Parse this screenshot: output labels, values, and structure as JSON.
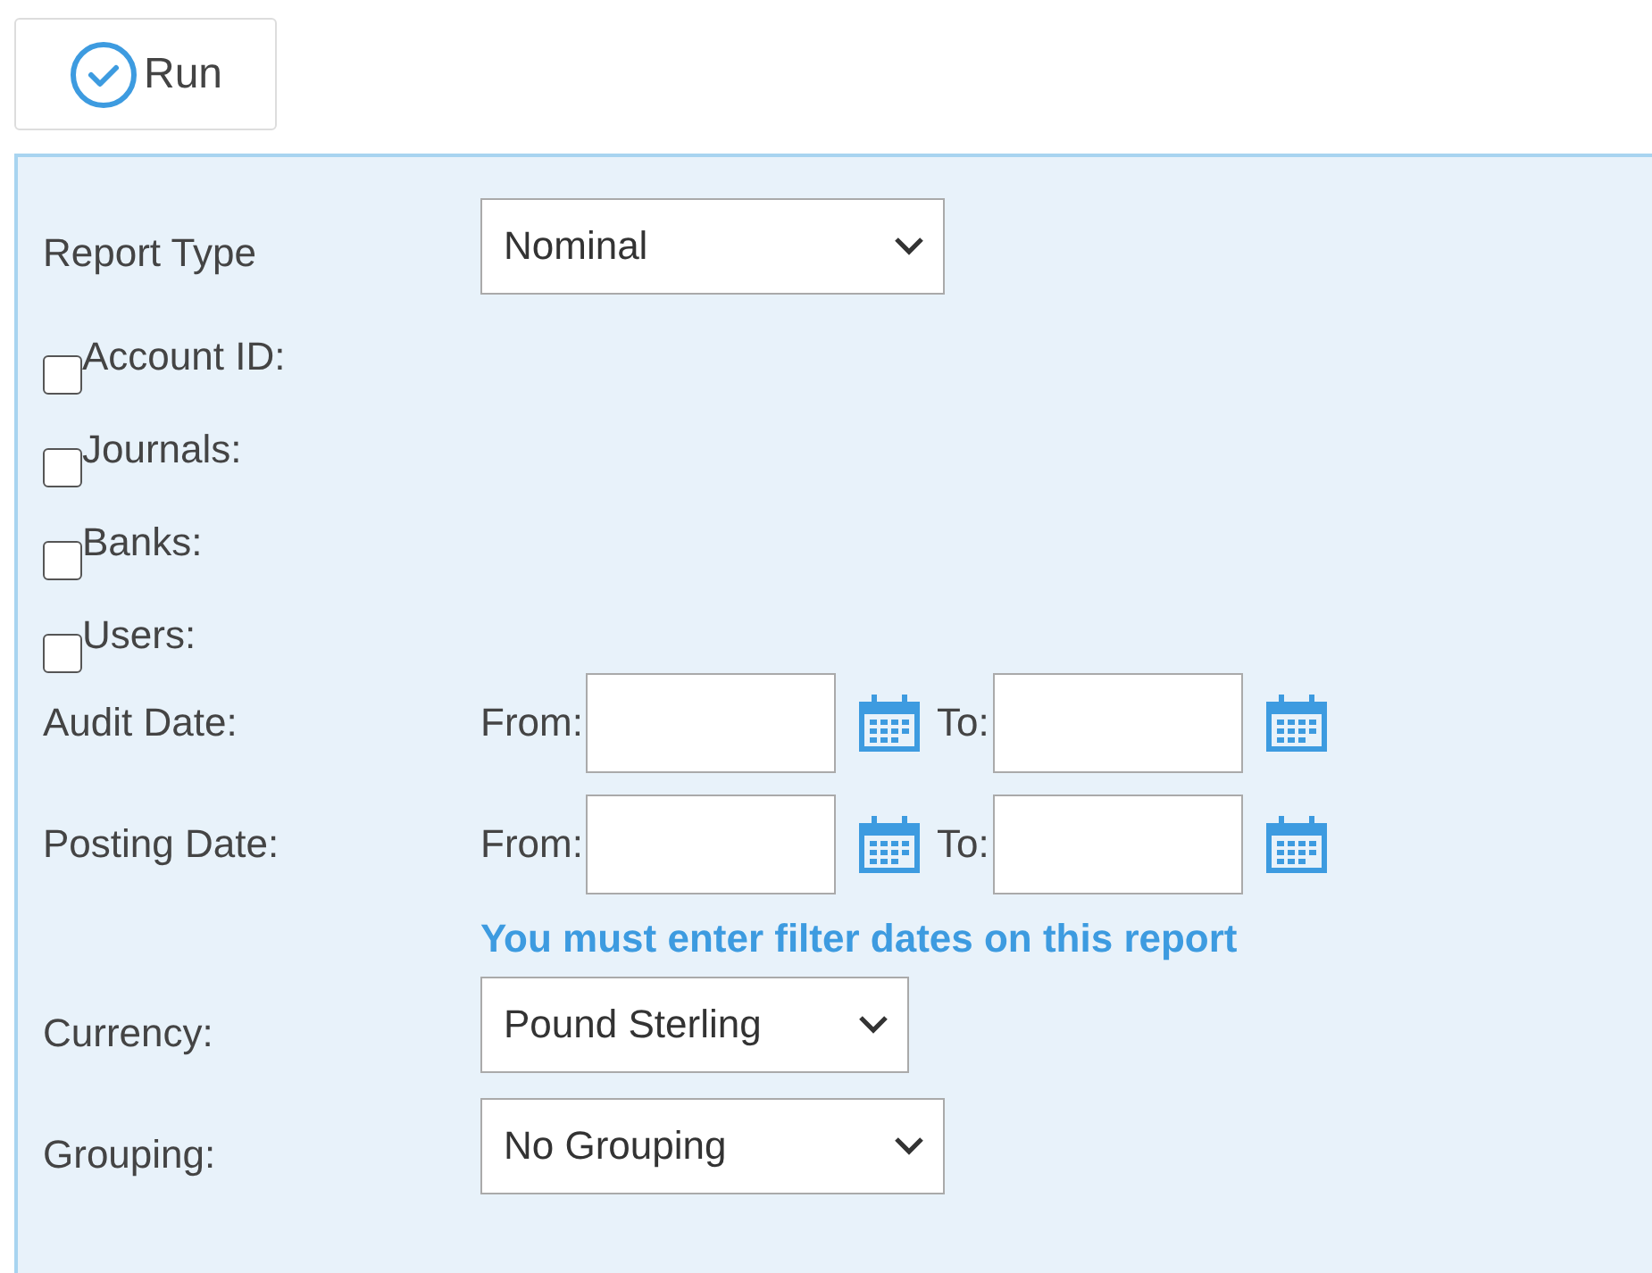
{
  "toolbar": {
    "run_button": "Run"
  },
  "report_type": {
    "label": "Report Type",
    "value": "Nominal"
  },
  "filters": [
    {
      "label": "Account ID:",
      "checked": false
    },
    {
      "label": "Journals:",
      "checked": false
    },
    {
      "label": "Banks:",
      "checked": false
    },
    {
      "label": "Users:",
      "checked": false
    }
  ],
  "date_ranges": [
    {
      "label": "Audit Date:",
      "from_label": "From:",
      "to_label": "To:"
    },
    {
      "label": "Posting Date:",
      "from_label": "From:",
      "to_label": "To:"
    }
  ],
  "warning": "You must enter filter dates on this report",
  "currency": {
    "label": "Currency:",
    "value": "Pound Sterling"
  },
  "grouping": {
    "label": "Grouping:",
    "value": "No Grouping"
  }
}
